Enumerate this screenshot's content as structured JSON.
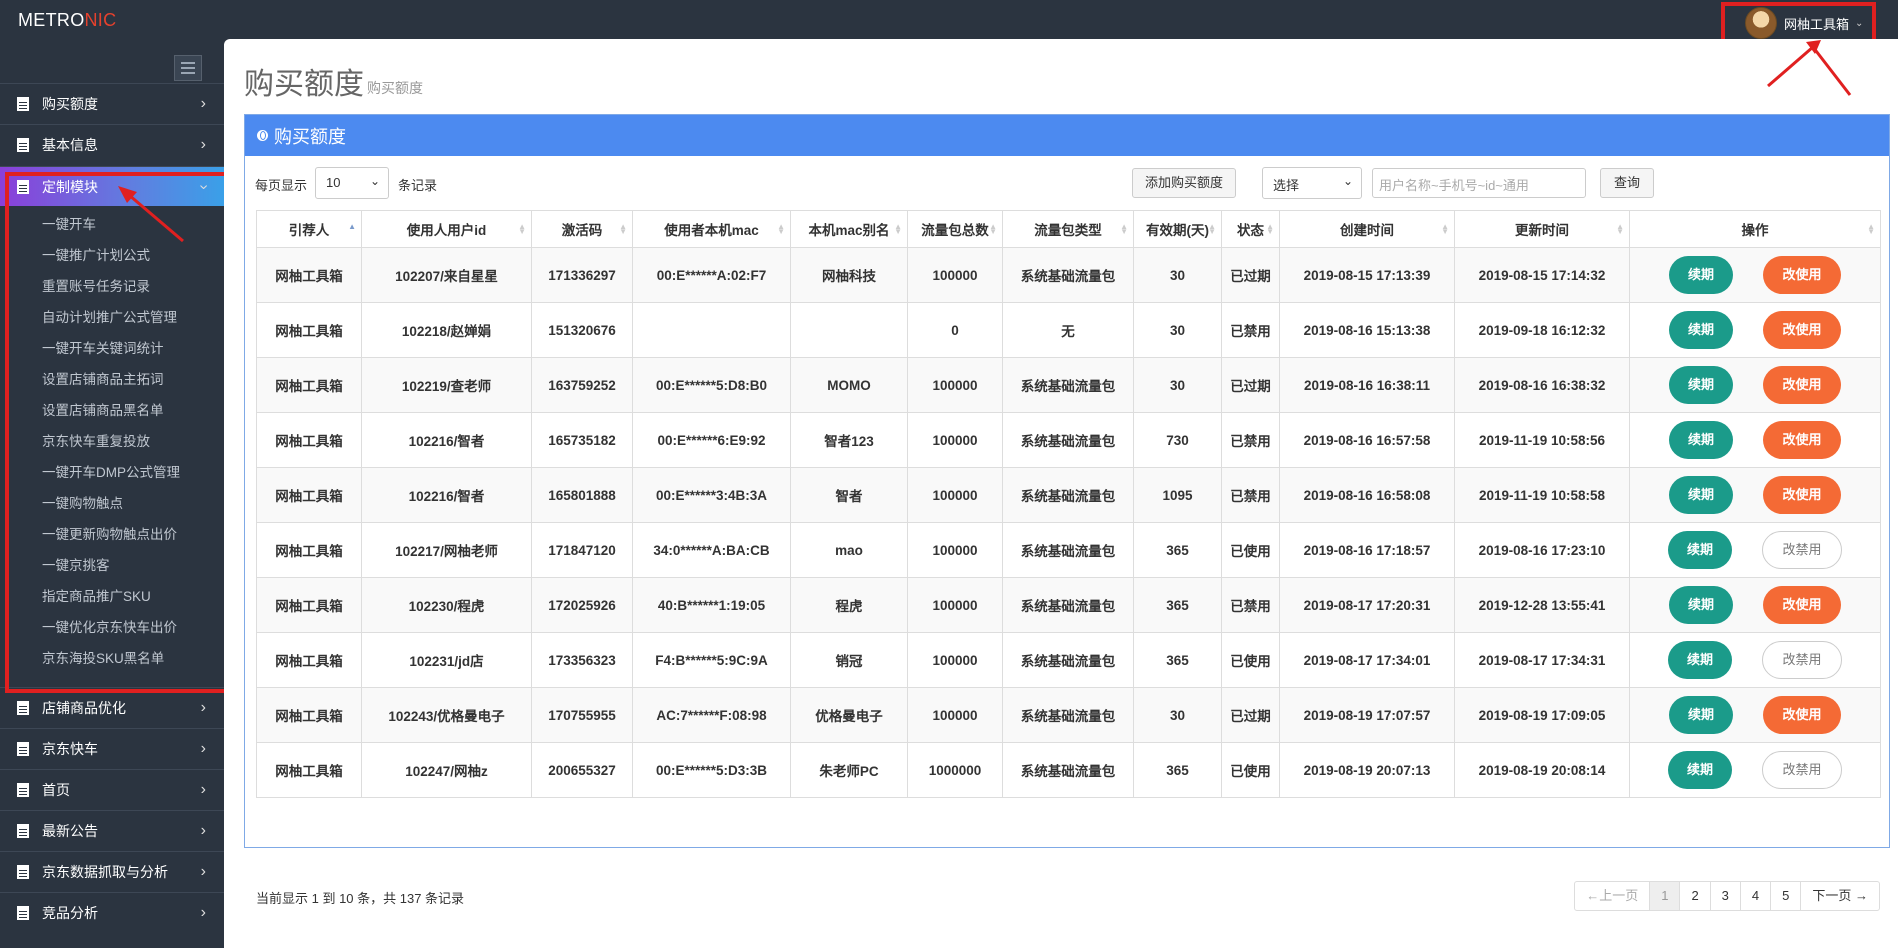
{
  "app": {
    "logo_main": "METRO",
    "logo_accent": "NIC"
  },
  "header": {
    "user_name": "网柚工具箱"
  },
  "sidebar": {
    "items_top": [
      {
        "label": "购买额度"
      },
      {
        "label": "基本信息"
      },
      {
        "label": "定制模块"
      }
    ],
    "submenu": [
      "一键开车",
      "一键推广计划公式",
      "重置账号任务记录",
      "自动计划推广公式管理",
      "一键开车关键词统计",
      "设置店铺商品主拓词",
      "设置店铺商品黑名单",
      "京东快车重复投放",
      "一键开车DMP公式管理",
      "一键购物触点",
      "一键更新购物触点出价",
      "一键京挑客",
      "指定商品推广SKU",
      "一键优化京东快车出价",
      "京东海投SKU黑名单"
    ],
    "items_bottom": [
      {
        "label": "店铺商品优化"
      },
      {
        "label": "京东快车"
      },
      {
        "label": "首页"
      },
      {
        "label": "最新公告"
      },
      {
        "label": "京东数据抓取与分析"
      },
      {
        "label": "竞品分析"
      }
    ]
  },
  "page": {
    "title": "购买额度",
    "subtitle": "购买额度"
  },
  "portlet": {
    "title": "购买额度"
  },
  "toolbar": {
    "per_page_prefix": "每页显示",
    "per_page_value": "10",
    "per_page_suffix": "条记录",
    "add_button": "添加购买额度",
    "filter_select": "选择",
    "search_placeholder": "用户名称~手机号~id~通用",
    "query_button": "查询"
  },
  "table": {
    "columns": [
      "引荐人",
      "使用人用户id",
      "激活码",
      "使用者本机mac",
      "本机mac别名",
      "流量包总数",
      "流量包类型",
      "有效期(天)",
      "状态",
      "创建时间",
      "更新时间",
      "操作"
    ],
    "renew_label": "续期",
    "change_label": "改使用",
    "change_label_alt": "改禁用",
    "rows": [
      {
        "referrer": "网柚工具箱",
        "user": "102207/来自星星",
        "code": "171336297",
        "mac": "00:E******A:02:F7",
        "alias": "网柚科技",
        "total": "100000",
        "type": "系统基础流量包",
        "days": "30",
        "status": "已过期",
        "created": "2019-08-15 17:13:39",
        "updated": "2019-08-15 17:14:32",
        "action": "enable"
      },
      {
        "referrer": "网柚工具箱",
        "user": "102218/赵婵娟",
        "code": "151320676",
        "mac": "",
        "alias": "",
        "total": "0",
        "type": "无",
        "days": "30",
        "status": "已禁用",
        "created": "2019-08-16 15:13:38",
        "updated": "2019-09-18 16:12:32",
        "action": "enable"
      },
      {
        "referrer": "网柚工具箱",
        "user": "102219/查老师",
        "code": "163759252",
        "mac": "00:E******5:D8:B0",
        "alias": "MOMO",
        "total": "100000",
        "type": "系统基础流量包",
        "days": "30",
        "status": "已过期",
        "created": "2019-08-16 16:38:11",
        "updated": "2019-08-16 16:38:32",
        "action": "enable"
      },
      {
        "referrer": "网柚工具箱",
        "user": "102216/智者",
        "code": "165735182",
        "mac": "00:E******6:E9:92",
        "alias": "智者123",
        "total": "100000",
        "type": "系统基础流量包",
        "days": "730",
        "status": "已禁用",
        "created": "2019-08-16 16:57:58",
        "updated": "2019-11-19 10:58:56",
        "action": "enable"
      },
      {
        "referrer": "网柚工具箱",
        "user": "102216/智者",
        "code": "165801888",
        "mac": "00:E******3:4B:3A",
        "alias": "智者",
        "total": "100000",
        "type": "系统基础流量包",
        "days": "1095",
        "status": "已禁用",
        "created": "2019-08-16 16:58:08",
        "updated": "2019-11-19 10:58:58",
        "action": "enable"
      },
      {
        "referrer": "网柚工具箱",
        "user": "102217/网柚老师",
        "code": "171847120",
        "mac": "34:0******A:BA:CB",
        "alias": "mao",
        "total": "100000",
        "type": "系统基础流量包",
        "days": "365",
        "status": "已使用",
        "created": "2019-08-16 17:18:57",
        "updated": "2019-08-16 17:23:10",
        "action": "disable"
      },
      {
        "referrer": "网柚工具箱",
        "user": "102230/程虎",
        "code": "172025926",
        "mac": "40:B******1:19:05",
        "alias": "程虎",
        "total": "100000",
        "type": "系统基础流量包",
        "days": "365",
        "status": "已禁用",
        "created": "2019-08-17 17:20:31",
        "updated": "2019-12-28 13:55:41",
        "action": "enable"
      },
      {
        "referrer": "网柚工具箱",
        "user": "102231/jd店",
        "code": "173356323",
        "mac": "F4:B******5:9C:9A",
        "alias": "销冠",
        "total": "100000",
        "type": "系统基础流量包",
        "days": "365",
        "status": "已使用",
        "created": "2019-08-17 17:34:01",
        "updated": "2019-08-17 17:34:31",
        "action": "disable"
      },
      {
        "referrer": "网柚工具箱",
        "user": "102243/优格曼电子",
        "code": "170755955",
        "mac": "AC:7******F:08:98",
        "alias": "优格曼电子",
        "total": "100000",
        "type": "系统基础流量包",
        "days": "30",
        "status": "已过期",
        "created": "2019-08-19 17:07:57",
        "updated": "2019-08-19 17:09:05",
        "action": "enable"
      },
      {
        "referrer": "网柚工具箱",
        "user": "102247/网柚z",
        "code": "200655327",
        "mac": "00:E******5:D3:3B",
        "alias": "朱老师PC",
        "total": "1000000",
        "type": "系统基础流量包",
        "days": "365",
        "status": "已使用",
        "created": "2019-08-19 20:07:13",
        "updated": "2019-08-19 20:08:14",
        "action": "disable"
      }
    ]
  },
  "footer": {
    "info": "当前显示 1 到 10 条，共 137 条记录"
  },
  "pagination": {
    "prev": "←上一页",
    "pages": [
      "1",
      "2",
      "3",
      "4",
      "5"
    ],
    "next": "下一页 →"
  }
}
